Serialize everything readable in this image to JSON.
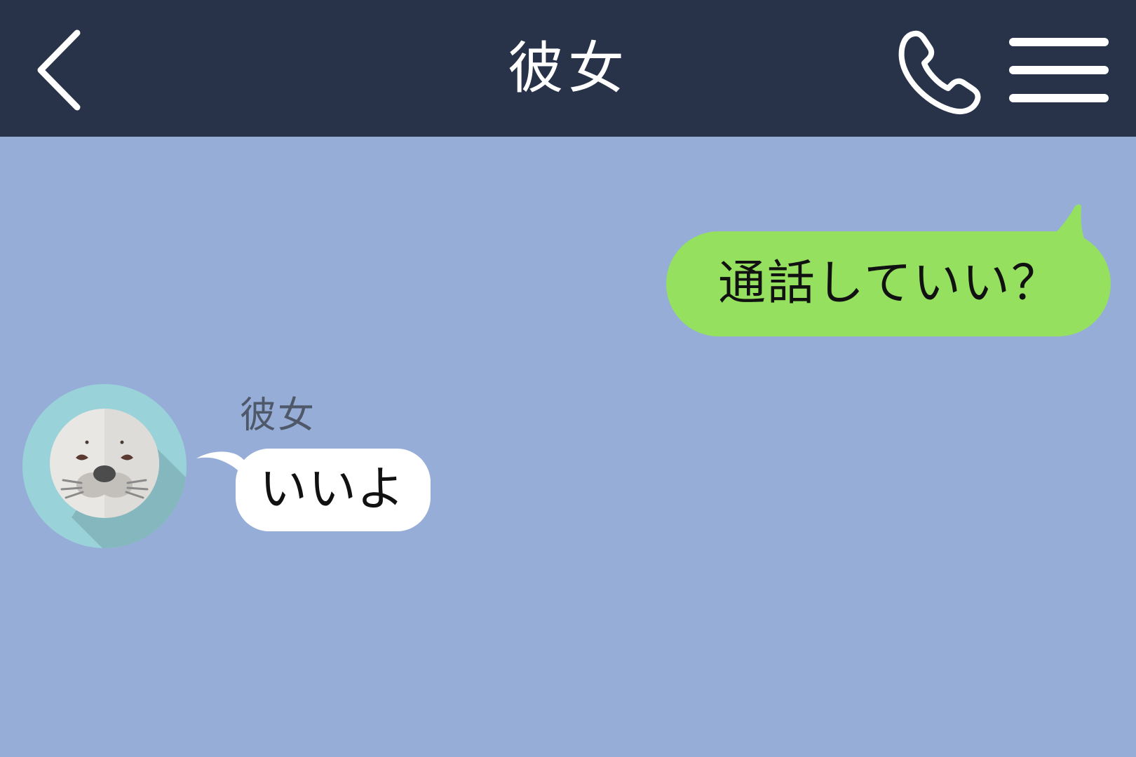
{
  "header": {
    "title": "彼女",
    "back_icon": "chevron-left-icon",
    "call_icon": "phone-icon",
    "menu_icon": "hamburger-menu-icon"
  },
  "messages": [
    {
      "direction": "sent",
      "text": "通話していい？"
    },
    {
      "direction": "received",
      "sender": "彼女",
      "text": "いいよ",
      "avatar_icon": "seal-avatar-icon"
    }
  ],
  "colors": {
    "header_bg": "#283249",
    "chat_bg": "#96aed7",
    "sent_bubble": "#95e05e",
    "received_bubble": "#ffffff"
  }
}
